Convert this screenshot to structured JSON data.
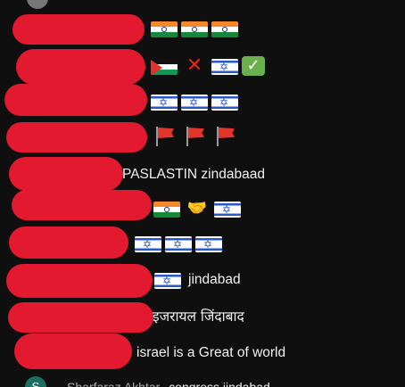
{
  "comments": [
    {
      "text": "",
      "emojis": [
        "india-flag",
        "india-flag",
        "india-flag"
      ]
    },
    {
      "text": "",
      "emojis": [
        "palestine-flag",
        "cross-mark",
        "israel-flag",
        "check-mark"
      ]
    },
    {
      "text": "",
      "emojis": [
        "israel-flag",
        "israel-flag",
        "israel-flag"
      ]
    },
    {
      "text": "",
      "emojis": [
        "red-flag",
        "red-flag",
        "red-flag"
      ]
    },
    {
      "text": "PASLASTIN zindabaad",
      "emojis": []
    },
    {
      "text": "",
      "emojis": [
        "india-flag",
        "handshake",
        "israel-flag"
      ]
    },
    {
      "text": "",
      "emojis": [
        "israel-flag",
        "israel-flag",
        "israel-flag"
      ]
    },
    {
      "text": "jindabad",
      "emojis": [
        "israel-flag"
      ]
    },
    {
      "text": "इजरायल जिंदाबाद",
      "emojis": []
    },
    {
      "text": "israel is a Great of world",
      "emojis": []
    }
  ],
  "bottom": {
    "avatar_letter": "S",
    "name": "Sharfaraz Akhtar",
    "text": "congress jindabad"
  }
}
